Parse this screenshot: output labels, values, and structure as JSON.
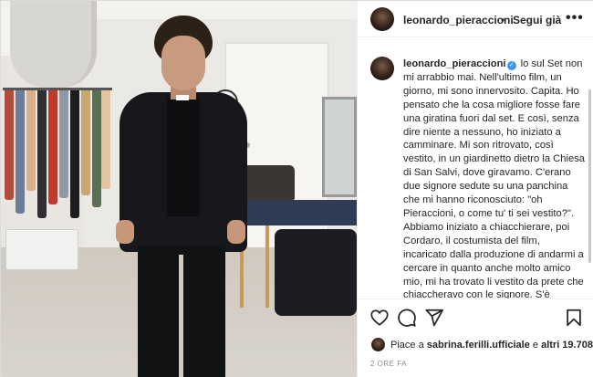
{
  "post": {
    "username": "leonardo_pieraccioni",
    "follow_dot": "•",
    "follow_label": "Segui già",
    "more_label": "•••",
    "verified_glyph": "✓",
    "caption_text": "lo sul Set non mi arrabbio mai. Nell'ultimo film, un giorno, mi sono innervosito. Capita. Ho pensato che la cosa migliore fosse fare una giratina fuori dal set. E così, senza dire niente a nessuno, ho iniziato a camminare. Mi son ritrovato, così vestito, in un giardinetto dietro la Chiesa di San Salvi, dove giravamo. C'erano due signore sedute su una panchina che mi hanno riconosciuto: \"oh Pieraccioni, o come tu' ti sei vestito?\". Abbiamo iniziato a chiacchierare, poi Cordaro, il costumista del film, incaricato dalla produzione di andarmi a cercare in quanto anche molto amico mio, mi ha trovato li vestito da prete che chiaccheravo con le signore. S'è avvicinato, ha detto solo \"scusate\", m'ha preso per mano e mi ha riportato sul Set.",
    "likes_prefix": "Piace a ",
    "likes_user": "sabrina.ferilli.ufficiale",
    "likes_middle": " e ",
    "likes_others": "altri 19.708",
    "timestamp": "2 ORE FA"
  },
  "icons": {
    "like": "heart-icon",
    "comment": "comment-icon",
    "share": "share-icon",
    "save": "bookmark-icon",
    "more": "more-options-icon"
  },
  "colors": {
    "verified": "#3897f0",
    "text": "#262626",
    "muted": "#8e8e8e",
    "border": "#efefef"
  }
}
